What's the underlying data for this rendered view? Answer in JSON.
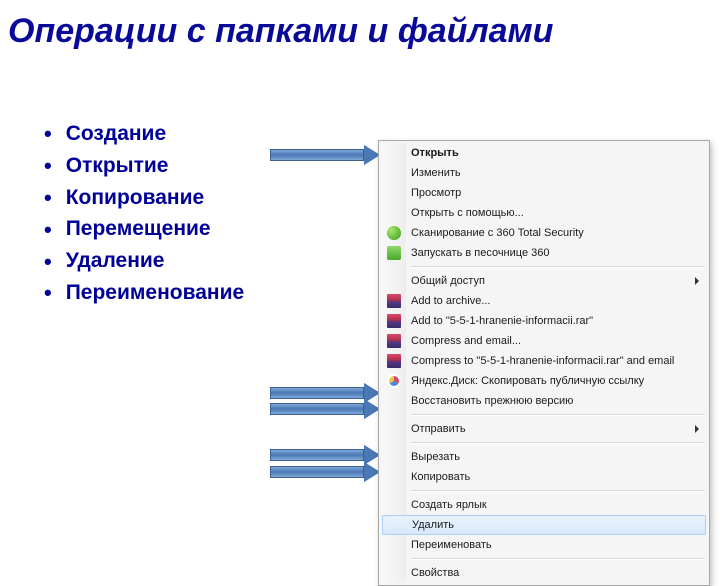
{
  "title": "Операции с папками и файлами",
  "bullets": [
    "Создание",
    "Открытие",
    "Копирование",
    "Перемещение",
    "Удаление",
    "Переименование"
  ],
  "menu": {
    "open": "Открыть",
    "edit": "Изменить",
    "view": "Просмотр",
    "open_with": "Открыть с помощью...",
    "scan_360": "Сканирование с 360 Total Security",
    "sandbox_360": "Запускать в песочнице 360",
    "share": "Общий доступ",
    "add_archive": "Add to archive...",
    "add_rar": "Add to \"5-5-1-hranenie-informacii.rar\"",
    "compress_email": "Compress and email...",
    "compress_rar_email": "Compress to \"5-5-1-hranenie-informacii.rar\" and email",
    "yandex_disk": "Яндекс.Диск: Скопировать публичную ссылку",
    "restore": "Восстановить прежнюю версию",
    "send_to": "Отправить",
    "cut": "Вырезать",
    "copy": "Копировать",
    "create_shortcut": "Создать ярлык",
    "delete": "Удалить",
    "rename": "Переименовать",
    "properties": "Свойства"
  }
}
